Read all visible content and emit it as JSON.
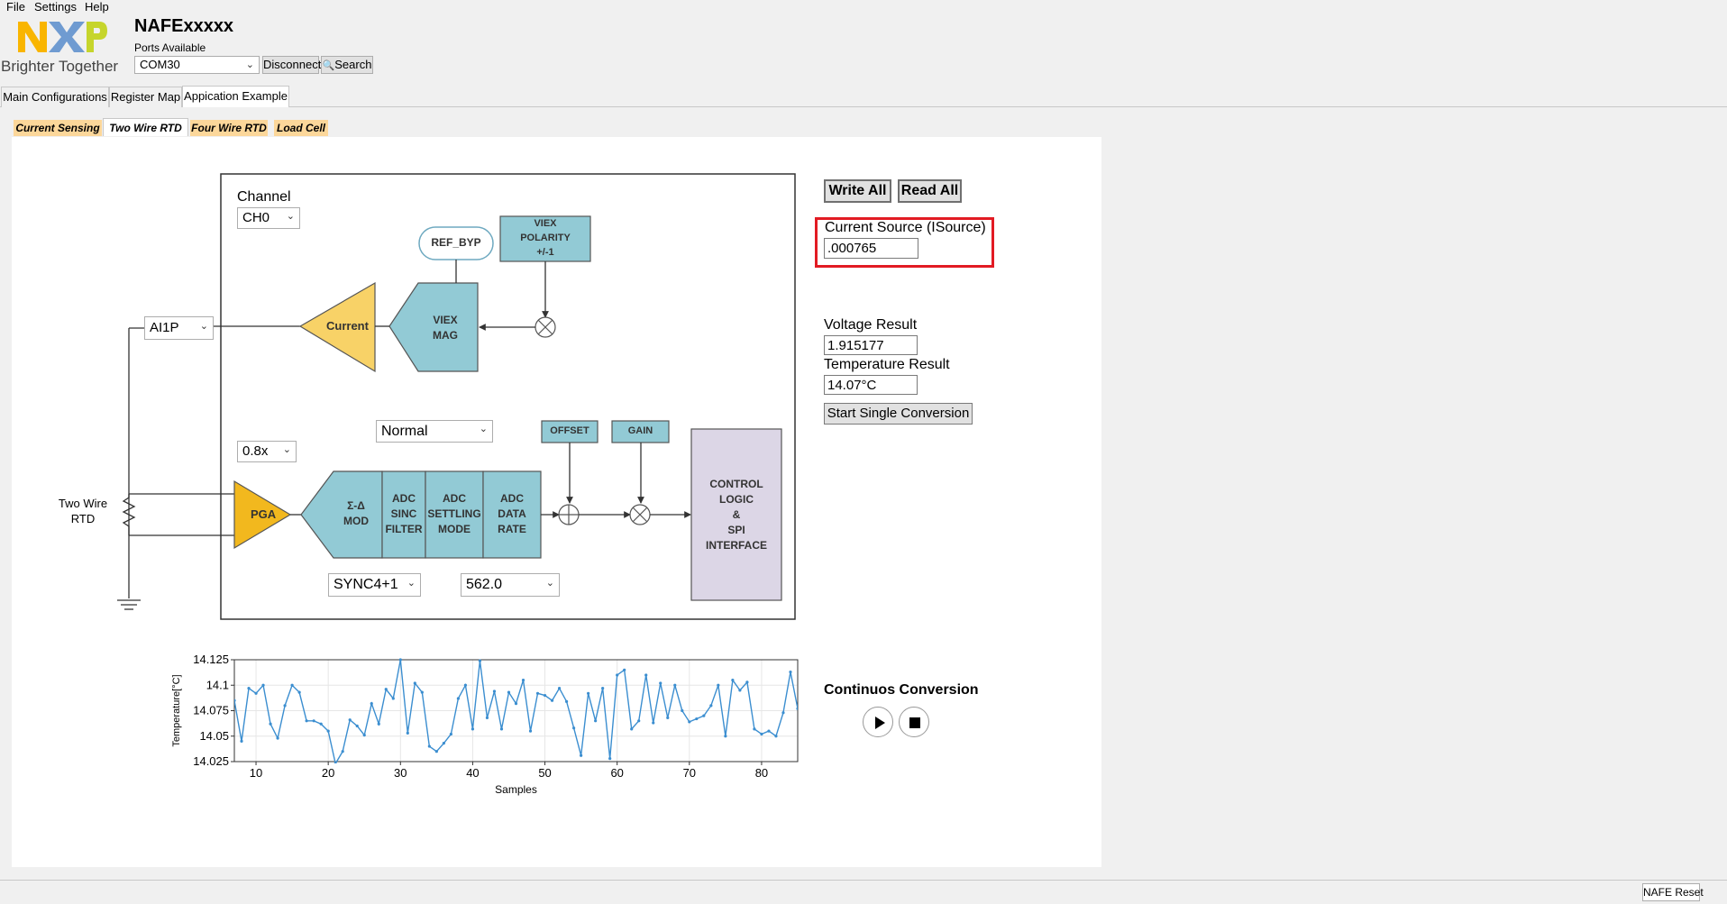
{
  "menu": [
    "File",
    "Settings",
    "Help"
  ],
  "brand": {
    "logo_text": "NXP",
    "tagline": "Brighter Together",
    "colors": {
      "n": "#f9b500",
      "x": "#6f9bd1",
      "p": "#c6d52c"
    }
  },
  "header": {
    "title": "NAFExxxxx",
    "ports_label": "Ports Available",
    "port_value": "COM30",
    "disconnect_label": "Disconnect",
    "search_label": "Search"
  },
  "main_tabs": [
    "Main Configurations",
    "Register Map",
    "Appication Example"
  ],
  "sub_tabs": [
    "Current Sensing",
    "Two Wire RTD",
    "Four Wire RTD",
    "Load Cell"
  ],
  "diagram": {
    "channel_label": "Channel",
    "channel_value": "CH0",
    "input_value": "AI1P",
    "mode_value": "Normal",
    "gain_value": "0.8x",
    "filter_value": "SYNC4+1",
    "rate_value": "562.0",
    "rtd_label": [
      "Two Wire",
      "RTD"
    ],
    "blocks": {
      "ref_byp": "REF_BYP",
      "viex_polarity": [
        "VIEX",
        "POLARITY",
        "+/-1"
      ],
      "viex_mag": [
        "VIEX",
        "MAG"
      ],
      "current": "Current",
      "offset": "OFFSET",
      "gain": "GAIN",
      "pga": "PGA",
      "sigma_delta": [
        "Σ-Δ",
        "MOD"
      ],
      "adc_sinc": [
        "ADC",
        "SINC",
        "FILTER"
      ],
      "adc_settling": [
        "ADC",
        "SETTLING",
        "MODE"
      ],
      "adc_rate": [
        "ADC",
        "DATA",
        "RATE"
      ],
      "control": [
        "CONTROL",
        "LOGIC",
        "&",
        "SPI",
        "INTERFACE"
      ]
    },
    "colors": {
      "block": "#92cad5",
      "amp": "#f8d267",
      "pga": "#f2b81e",
      "control": "#dcd6e6"
    }
  },
  "controls": {
    "write_all": "Write All",
    "read_all": "Read All",
    "isource_label": "Current Source (ISource)",
    "isource_value": ".000765",
    "voltage_label": "Voltage Result",
    "voltage_value": "1.915177",
    "temp_label": "Temperature Result",
    "temp_value": "14.07°C",
    "start_label": "Start Single Conversion",
    "continuous_label": "Continuos Conversion"
  },
  "chart_data": {
    "type": "line",
    "title": "",
    "xlabel": "Samples",
    "ylabel": "Temperature[°C]",
    "xlim": [
      7,
      85
    ],
    "ylim": [
      14.025,
      14.125
    ],
    "xticks": [
      10,
      20,
      30,
      40,
      50,
      60,
      70,
      80
    ],
    "yticks": [
      14.025,
      14.05,
      14.075,
      14.1,
      14.125
    ],
    "ytick_labels": [
      "14.025",
      "14.05",
      "14.075",
      "14.1",
      "14.125"
    ],
    "grid": true,
    "color": "#3b8ed0",
    "x": [
      7,
      8,
      9,
      10,
      11,
      12,
      13,
      14,
      15,
      16,
      17,
      18,
      19,
      20,
      21,
      22,
      23,
      24,
      25,
      26,
      27,
      28,
      29,
      30,
      31,
      32,
      33,
      34,
      35,
      36,
      37,
      38,
      39,
      40,
      41,
      42,
      43,
      44,
      45,
      46,
      47,
      48,
      49,
      50,
      51,
      52,
      53,
      54,
      55,
      56,
      57,
      58,
      59,
      60,
      61,
      62,
      63,
      64,
      65,
      66,
      67,
      68,
      69,
      70,
      71,
      72,
      73,
      74,
      75,
      76,
      77,
      78,
      79,
      80,
      81,
      82,
      83,
      84,
      85
    ],
    "y": [
      14.085,
      14.045,
      14.097,
      14.092,
      14.1,
      14.062,
      14.048,
      14.08,
      14.1,
      14.093,
      14.065,
      14.065,
      14.062,
      14.055,
      14.023,
      14.035,
      14.066,
      14.06,
      14.051,
      14.082,
      14.062,
      14.096,
      14.087,
      14.125,
      14.053,
      14.102,
      14.093,
      14.04,
      14.035,
      14.043,
      14.052,
      14.087,
      14.1,
      14.057,
      14.124,
      14.068,
      14.094,
      14.057,
      14.093,
      14.082,
      14.105,
      14.055,
      14.092,
      14.09,
      14.085,
      14.097,
      14.084,
      14.058,
      14.031,
      14.092,
      14.065,
      14.097,
      14.028,
      14.11,
      14.115,
      14.057,
      14.065,
      14.11,
      14.063,
      14.102,
      14.068,
      14.1,
      14.075,
      14.064,
      14.067,
      14.07,
      14.08,
      14.1,
      14.05,
      14.105,
      14.095,
      14.103,
      14.057,
      14.052,
      14.055,
      14.05,
      14.073,
      14.113,
      14.077
    ]
  }
}
